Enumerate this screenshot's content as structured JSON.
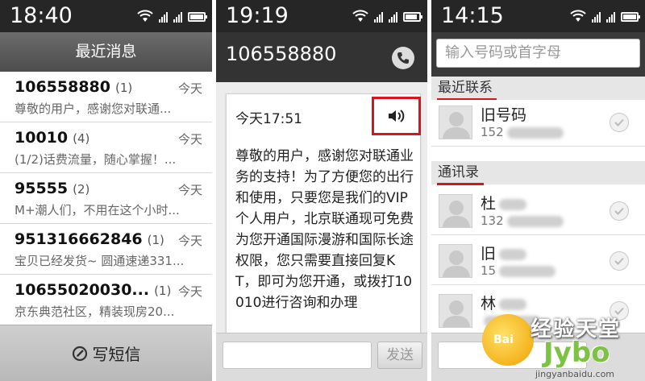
{
  "panel_messages": {
    "status_time": "18:40",
    "title": "最近消息",
    "conversations": [
      {
        "name": "106558880",
        "count": "(1)",
        "date": "今天",
        "preview": "尊敬的用户，感谢您对联通..."
      },
      {
        "name": "10010",
        "count": "(4)",
        "date": "今天",
        "preview": "(1/2)话费流量，随心掌握！..."
      },
      {
        "name": "95555",
        "count": "(2)",
        "date": "今天",
        "preview": "M+潮人们，不用在这个小时..."
      },
      {
        "name": "951316662846",
        "count": "(1)",
        "date": "今天",
        "preview": "宝贝已经发货~ 圆通速递331..."
      },
      {
        "name": "10655020030...",
        "count": "(1)",
        "date": "今天",
        "preview": "京东典范社区，精装现房20..."
      }
    ],
    "compose_label": "写短信"
  },
  "panel_thread": {
    "status_time": "19:19",
    "contact_number": "106558880",
    "message_time": "今天17:51",
    "message_text": "尊敬的用户，感谢您对联通业务的支持！为了方便您的出行和使用，只要您是我们的VIP个人用户，北京联通现可免费为您开通国际漫游和国际长途权限，您只需要直接回复KT，即可为您开通，或拨打10010进行咨询和办理",
    "send_label": "发送"
  },
  "panel_contacts": {
    "status_time": "14:15",
    "search_placeholder": "输入号码或首字母",
    "recent_header": "最近联系",
    "recent_contacts": [
      {
        "name": "旧号码",
        "phone": "152"
      }
    ],
    "contacts_header": "通讯录",
    "contacts": [
      {
        "name": "杜",
        "phone": "132"
      },
      {
        "name": "旧",
        "phone": "15"
      },
      {
        "name": "林",
        "phone": ""
      }
    ]
  },
  "watermark": {
    "logo_text": "Bai",
    "site_name": "经验天堂",
    "brand": "Jybo",
    "url": "jingyanbaidu.com"
  },
  "colors": {
    "highlight_red": "#d9141c",
    "header_dark": "#333333",
    "watermark_green": "#7dc242"
  }
}
